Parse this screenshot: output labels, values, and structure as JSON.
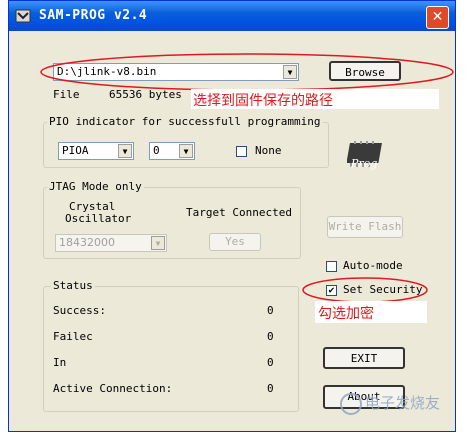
{
  "window": {
    "title": "SAM-PROG v2.4",
    "close_symbol": "✕"
  },
  "file_selector": {
    "value": "D:\\jlink-v8.bin",
    "browse_label": "Browse"
  },
  "file_info": {
    "label": "File",
    "size": "65536 bytes"
  },
  "annotations": {
    "path_note": "选择到固件保存的路径",
    "security_note": "勾选加密"
  },
  "pio": {
    "group_label": "PIO indicator for successfull programming",
    "port_value": "PIOA",
    "pin_value": "0",
    "none_label": "None",
    "none_checked": false
  },
  "prog_icon_label": "Prog",
  "jtag": {
    "group_label": "JTAG Mode only",
    "crystal_label_1": "Crystal",
    "crystal_label_2": "Oscillator",
    "target_label": "Target Connected",
    "frequency_value": "18432000",
    "yes_label": "Yes"
  },
  "write_flash_label": "Write Flash",
  "auto_mode": {
    "label": "Auto-mode",
    "checked": false
  },
  "set_security": {
    "label": "Set Security",
    "checked": true
  },
  "status": {
    "group_label": "Status",
    "rows": [
      {
        "label": "Success:",
        "value": "0"
      },
      {
        "label": "Failec",
        "value": "0"
      },
      {
        "label": "In",
        "value": "0"
      },
      {
        "label": "Active Connection:",
        "value": "0"
      }
    ]
  },
  "exit_label": "EXIT",
  "about_label": "About",
  "watermark": "电子发烧友",
  "colors": {
    "annotation_red": "#e0191f",
    "title_blue": "#0054e3"
  }
}
